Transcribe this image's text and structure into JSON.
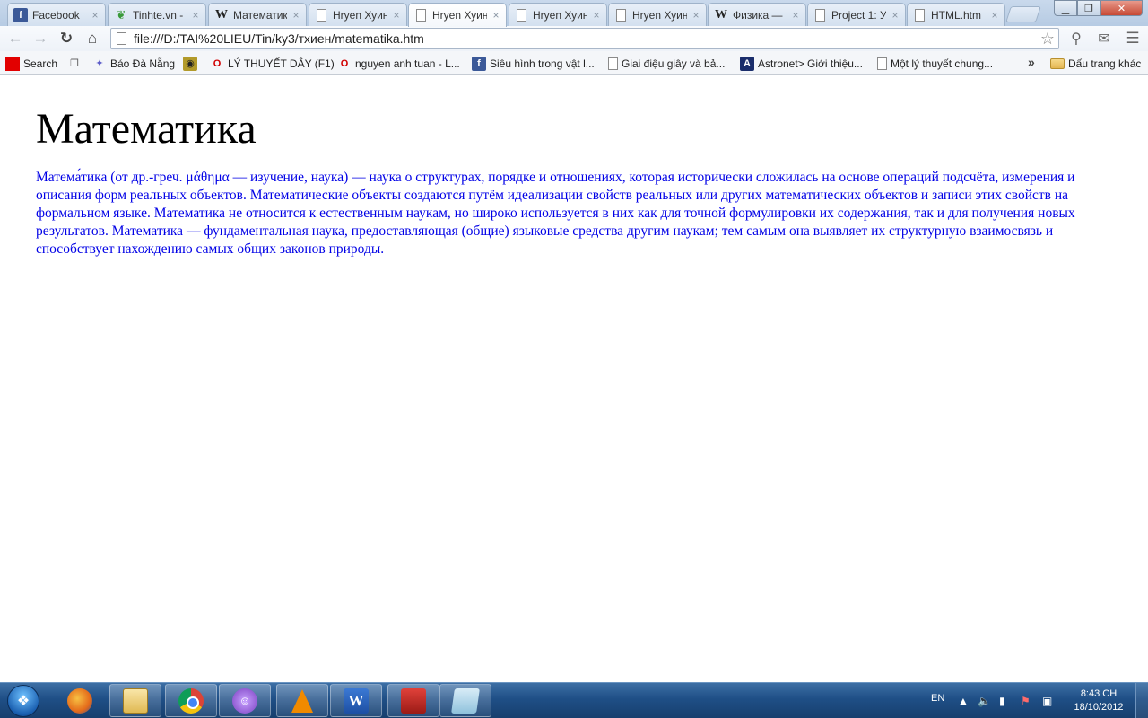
{
  "browser": {
    "tabs": [
      {
        "title": "Facebook",
        "favicon": "facebook-icon"
      },
      {
        "title": "Tinhte.vn -",
        "favicon": "leaf-icon"
      },
      {
        "title": "Математик",
        "favicon": "wikipedia-icon"
      },
      {
        "title": "Hryen Хуин",
        "favicon": "page-icon"
      },
      {
        "title": "Hryen Хуин",
        "favicon": "page-icon",
        "active": true
      },
      {
        "title": "Hryen Хуин",
        "favicon": "page-icon"
      },
      {
        "title": "Hryen Хуин",
        "favicon": "page-icon"
      },
      {
        "title": "Физика — I",
        "favicon": "wikipedia-icon"
      },
      {
        "title": "Project 1: У",
        "favicon": "page-icon"
      },
      {
        "title": "HTML.htm",
        "favicon": "page-icon"
      }
    ],
    "tab_close_glyph": "×",
    "url": "file:///D:/TAI%20LIEU/Tin/ky3/тхиен/matematika.htm",
    "bookmarks": [
      {
        "label": "Search",
        "icon": "red-square-icon"
      },
      {
        "label": "",
        "icon": "copy-icon"
      },
      {
        "label": "Báo Đà Nẵng",
        "icon": "diamond-icon"
      },
      {
        "label": "",
        "icon": "emblem-icon"
      },
      {
        "label": "LÝ THUYẾT DÂY (F1)",
        "icon": "opera-icon"
      },
      {
        "label": "nguyen anh tuan - L...",
        "icon": "opera-icon"
      },
      {
        "label": "Siêu hình trong vật l...",
        "icon": "facebook-icon"
      },
      {
        "label": "Giai điệu giây và bả...",
        "icon": "page-icon"
      },
      {
        "label": "Astronet> Giới thiệu...",
        "icon": "astronet-icon"
      },
      {
        "label": "Một lý thuyết chung...",
        "icon": "page-icon"
      }
    ],
    "bookmarks_more": "»",
    "other_bookmarks": "Dấu trang khác"
  },
  "page": {
    "title": "Математика",
    "body": "Матема́тика (от др.-греч. μάθημα — изучение, наука) — наука о структурах, порядке и отношениях, которая исторически сложилась на основе операций подсчёта, измерения и описания форм реальных объектов. Математические объекты создаются путём идеализации свойств реальных или других математических объектов и записи этих свойств на формальном языке. Математика не относится к естественным наукам, но широко используется в них как для точной формулировки их содержания, так и для получения новых результатов. Математика — фундаментальная наука, предоставляющая (общие) языковые средства другим наукам; тем самым она выявляет их структурную взаимосвязь и способствует нахождению самых общих законов природы.",
    "text_color": "#0000e6"
  },
  "taskbar": {
    "apps": [
      "firefox-icon",
      "explorer-icon",
      "chrome-icon",
      "yahoo-messenger-icon",
      "vlc-icon",
      "word-icon",
      "books-icon",
      "notepad-icon"
    ],
    "language": "EN",
    "time": "8:43 CH",
    "date": "18/10/2012"
  }
}
